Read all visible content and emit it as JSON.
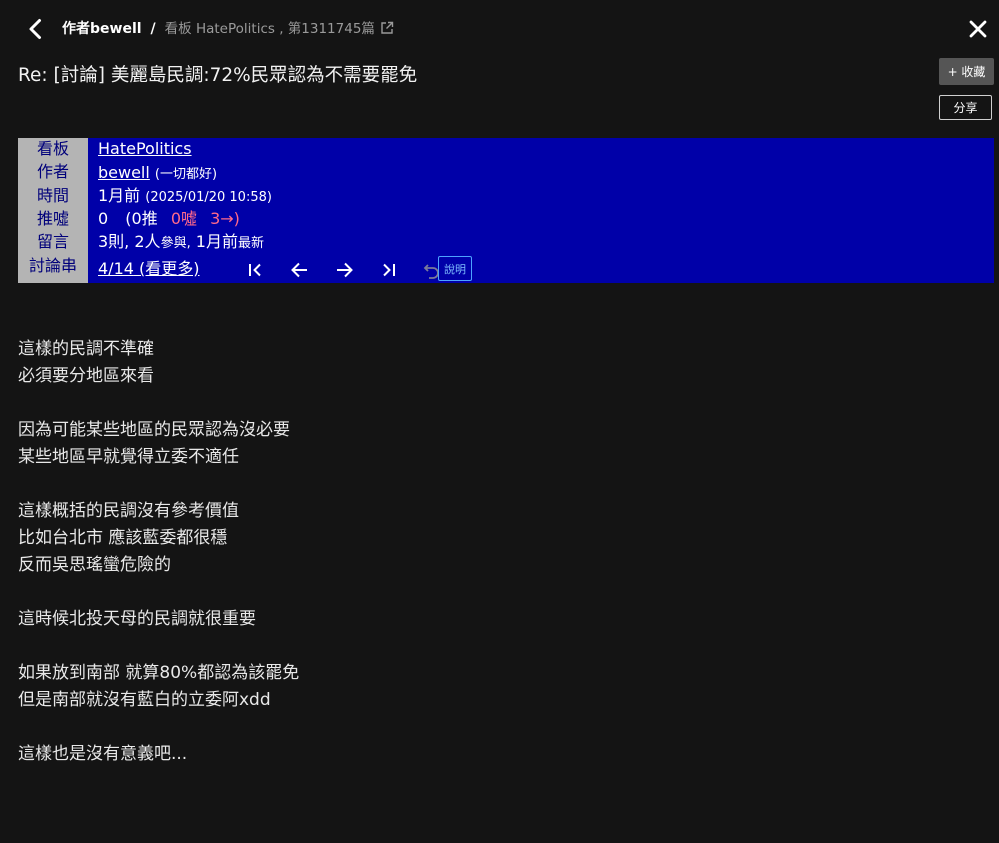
{
  "header": {
    "author_label": "作者bewell",
    "separator": "/",
    "board_info": "看板 HatePolitics , 第1311745篇"
  },
  "title": "Re: [討論] 美麗島民調:72%民眾認為不需要罷免",
  "buttons": {
    "favorite": "+ 收藏",
    "share": "分享",
    "help": "說明"
  },
  "meta": {
    "labels": [
      "看板",
      "作者",
      "時間",
      "推噓",
      "留言",
      "討論串"
    ],
    "board": "HatePolitics",
    "author": "bewell",
    "author_nick": "(一切都好)",
    "time_rel": "1月前",
    "time_abs": "(2025/01/20 10:58)",
    "score": "0",
    "push_open": "(0推",
    "boo": "0噓",
    "arrow": "3→)",
    "comments_count": "3則,",
    "participants": "2人",
    "participants_suffix": "參與,",
    "latest": "1月前",
    "latest_suffix": "最新",
    "thread_pos": "4/14",
    "thread_more": "(看更多)"
  },
  "content_lines": [
    "這樣的民調不準確",
    "必須要分地區來看",
    "",
    "因為可能某些地區的民眾認為沒必要",
    "某些地區早就覺得立委不適任",
    "",
    "這樣概括的民調沒有參考價值",
    "比如台北市 應該藍委都很穩",
    "反而吳思瑤蠻危險的",
    "",
    "這時候北投天母的民調就很重要",
    "",
    "如果放到南部 就算80%都認為該罷免",
    "但是南部就沒有藍白的立委阿xdd",
    "",
    "這樣也是沒有意義吧..."
  ],
  "colors": {
    "background": "#141414",
    "meta_bg": "#0000a8",
    "label_bg": "#b4b4b4",
    "boo": "#ff6a8a",
    "help_border": "#4da3ff"
  },
  "icons": [
    "back-arrow-icon",
    "external-link-icon",
    "close-icon",
    "first-page-icon",
    "previous-icon",
    "next-icon",
    "last-page-icon",
    "undo-icon"
  ]
}
